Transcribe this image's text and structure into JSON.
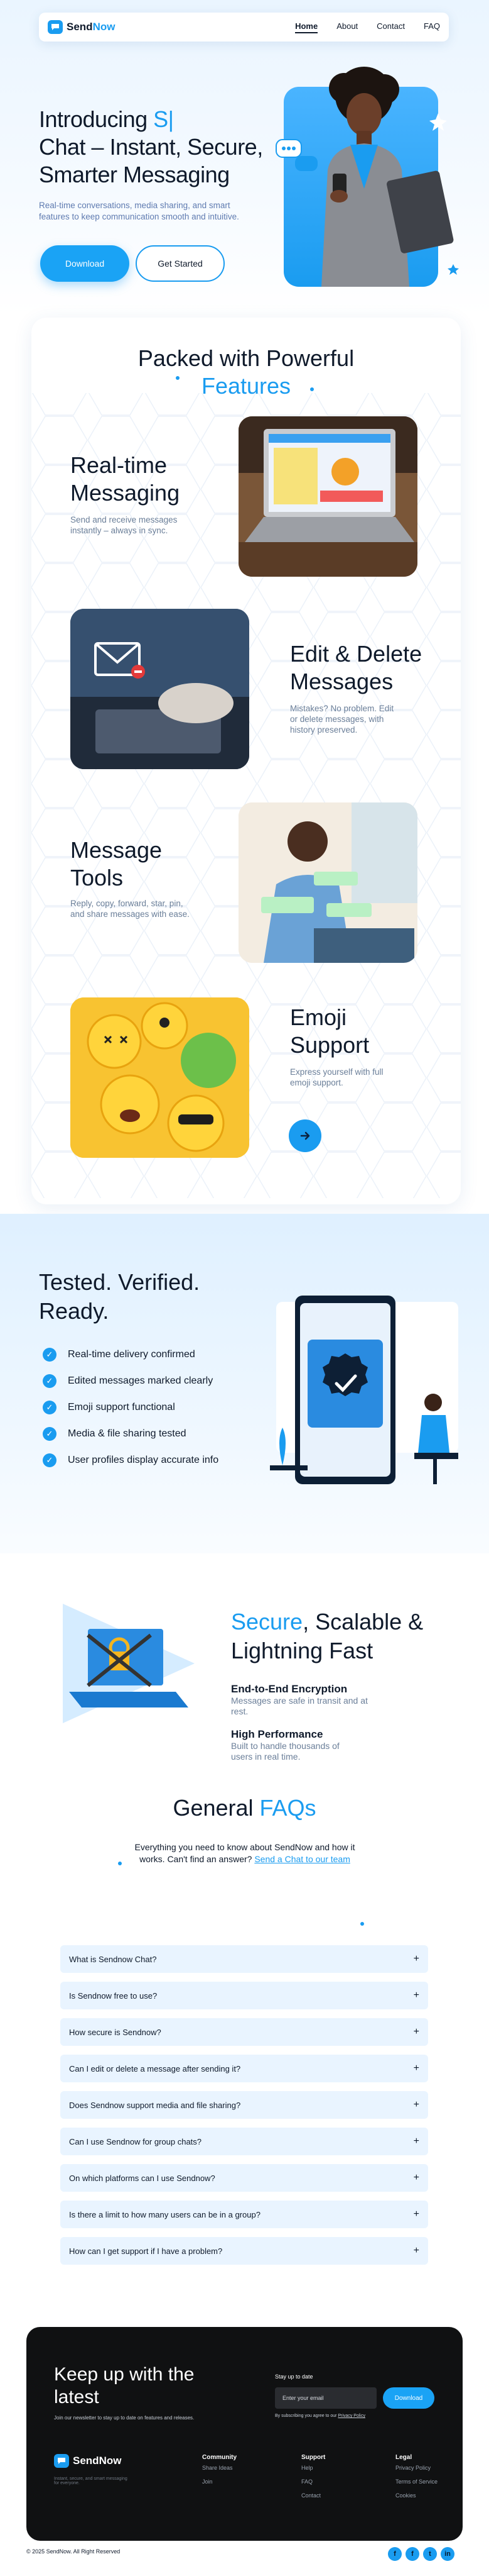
{
  "nav": {
    "logo_text_1": "Send",
    "logo_text_2": "Now",
    "links": [
      "Home",
      "About",
      "Contact",
      "FAQ"
    ]
  },
  "hero": {
    "title_line1": "Introducing ",
    "title_cursor": "S|",
    "title_line2": "Chat – Instant, Secure,",
    "title_line3": "Smarter Messaging",
    "subtitle": "Real-time conversations, media sharing, and smart features to keep communication smooth and intuitive.",
    "download_label": "Download",
    "get_started_label": "Get Started"
  },
  "features": {
    "title_line1": "Packed with Powerful",
    "title_line2": "Features",
    "items": [
      {
        "title_1": "Real-time",
        "title_2": "Messaging",
        "desc": "Send and receive messages instantly – always in sync."
      },
      {
        "title_1": "Edit & Delete",
        "title_2": "Messages",
        "desc": "Mistakes? No problem. Edit or delete messages, with history preserved."
      },
      {
        "title_1": "Message",
        "title_2": "Tools",
        "desc": "Reply, copy, forward, star, pin, and share messages with ease."
      },
      {
        "title_1": "Emoji",
        "title_2": "Support",
        "desc": "Express yourself with full emoji support."
      }
    ],
    "arrow_icon": "arrow-right-icon"
  },
  "tested": {
    "title_line1": "Tested. Verified.",
    "title_line2": "Ready.",
    "checks": [
      "Real-time delivery confirmed",
      "Edited messages marked clearly",
      "Emoji support functional",
      "Media & file sharing tested",
      "User profiles display accurate info"
    ]
  },
  "secure": {
    "title_blue": "Secure",
    "title_rest": ", Scalable &",
    "title_line2": "Lightning Fast",
    "items": [
      {
        "heading": "End-to-End Encryption",
        "desc": "Messages are safe in transit and at rest."
      },
      {
        "heading": "High Performance",
        "desc": "Built to handle thousands of users in real time."
      }
    ]
  },
  "faq": {
    "title_1": "General ",
    "title_2": "FAQs",
    "subtitle": "Everything you need to know about SendNow and how it works. Can't find an answer?",
    "subtitle_link": "Send a Chat to our team",
    "questions": [
      "What is Sendnow Chat?",
      "Is Sendnow free to use?",
      "How secure is Sendnow?",
      "Can I edit or delete a message after sending it?",
      "Does Sendnow support media and file sharing?",
      "Can I use Sendnow for group chats?",
      "On which platforms can I use Sendnow?",
      "Is there a limit to how many users can be in a group?",
      "How can I get support if I have a problem?"
    ]
  },
  "footer": {
    "title_line1": "Keep up with the",
    "title_line2": "latest",
    "subtitle": "Join our newsletter to stay up to date on features and releases.",
    "stay_label": "Stay up to date",
    "email_placeholder": "Enter your email",
    "subscribe_label": "Download",
    "privacy_note_1": "By subscribing you agree to our ",
    "privacy_note_link": "Privacy Policy",
    "brand_1": "Send",
    "brand_2": "Now",
    "brand_tagline": "Instant, secure, and smart messaging for everyone.",
    "columns": [
      {
        "heading": "Community",
        "items": [
          "Share Ideas",
          "Join"
        ]
      },
      {
        "heading": "Support",
        "items": [
          "Help",
          "FAQ",
          "Contact"
        ]
      },
      {
        "heading": "Legal",
        "items": [
          "Privacy Policy",
          "Terms of Service",
          "Cookies"
        ]
      }
    ],
    "copyright": "© 2025 SendNow. All Right Reserved",
    "socials": [
      "facebook-icon",
      "facebook-icon",
      "twitter-icon",
      "linkedin-icon"
    ]
  }
}
